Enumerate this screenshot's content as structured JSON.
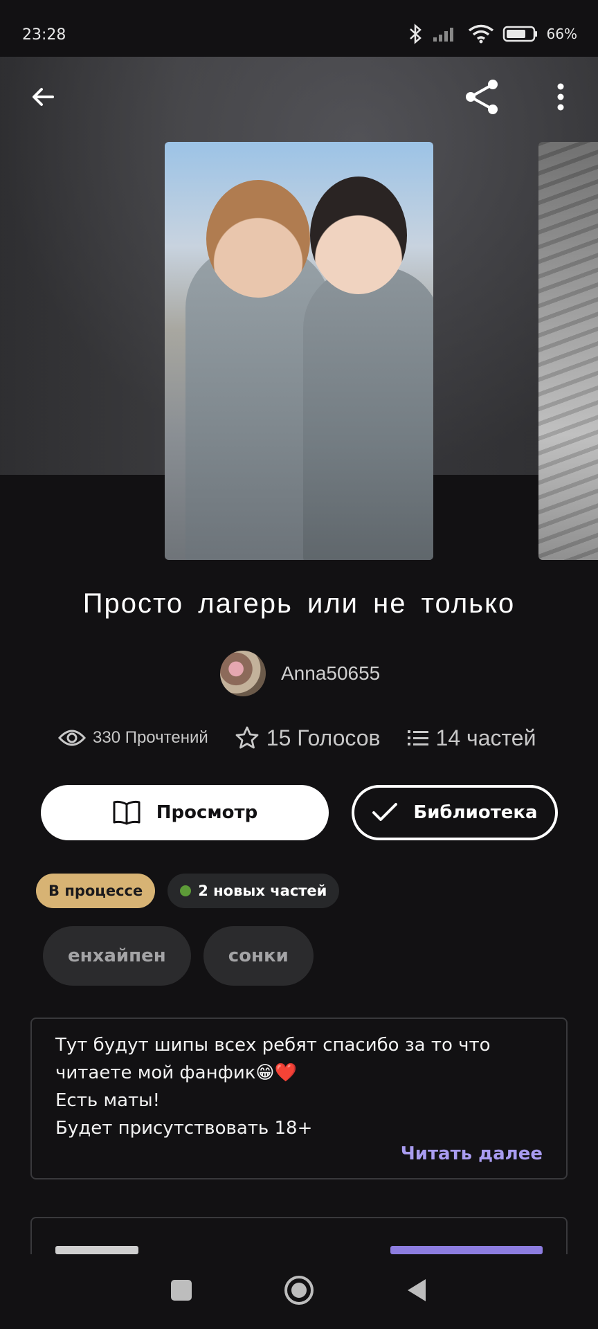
{
  "status_bar": {
    "time": "23:28",
    "battery": "66%"
  },
  "story": {
    "title": "Просто  лагерь  или  не  только",
    "author": "Anna50655",
    "stats": {
      "reads": "330 Прочтений",
      "votes": "15 Голосов",
      "parts": "14 частей"
    }
  },
  "actions": {
    "read_label": "Просмотр",
    "library_label": "Библиотека"
  },
  "badges": {
    "status": "В процессе",
    "new_parts": "2 новых частей"
  },
  "tags": [
    "енхайпен",
    "сонки"
  ],
  "description": {
    "lines": [
      "Тут будут шипы всех ребят спасибо за то что",
      "читаете мой фанфик😁❤️",
      "Есть маты!",
      "Будет присутствовать 18+"
    ],
    "read_more": "Читать далее"
  },
  "colors": {
    "accent": "#a99cf0",
    "status_badge": "#d7b374",
    "new_dot": "#5d9b38",
    "background": "#121113"
  },
  "icons": [
    "back-arrow-icon",
    "share-icon",
    "more-vert-icon",
    "eye-icon",
    "star-icon",
    "list-icon",
    "book-icon",
    "check-icon",
    "nav-recents-icon",
    "nav-home-icon",
    "nav-back-icon"
  ]
}
